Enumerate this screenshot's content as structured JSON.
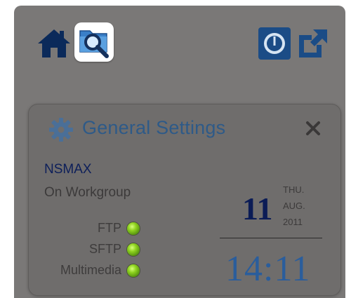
{
  "toolbar": {
    "home_icon": "home-icon",
    "search_icon": "folder-search-icon",
    "power_icon": "power-icon",
    "external_icon": "external-link-icon"
  },
  "widget": {
    "title": "General Settings",
    "hostname": "NSMAX",
    "workgroup": "On Workgroup",
    "services": [
      {
        "label": "FTP",
        "status": "active",
        "color": "#8ed21f"
      },
      {
        "label": "SFTP",
        "status": "active",
        "color": "#8ed21f"
      },
      {
        "label": "Multimedia",
        "status": "active",
        "color": "#8ed21f"
      }
    ],
    "date": {
      "weekday": "THU.",
      "day": "11",
      "month": "AUG.",
      "year": "2011"
    },
    "time": "14:11"
  },
  "colors": {
    "title": "#2e5a88",
    "hostname": "#0d1f5a",
    "time": "#2a5d9c",
    "background": "#7a7877"
  }
}
